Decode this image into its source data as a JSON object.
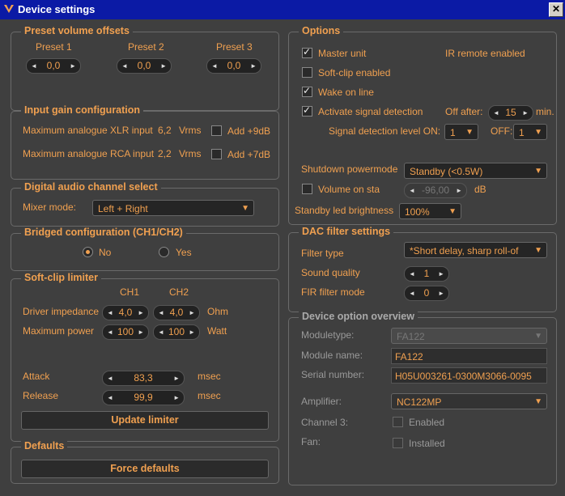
{
  "window": {
    "title": "Device settings",
    "close": "✕"
  },
  "preset": {
    "legend": "Preset volume offsets",
    "items": [
      {
        "label": "Preset 1",
        "value": "0,0"
      },
      {
        "label": "Preset 2",
        "value": "0,0"
      },
      {
        "label": "Preset 3",
        "value": "0,0"
      }
    ]
  },
  "input_gain": {
    "legend": "Input gain configuration",
    "xlr_label": "Maximum analogue XLR input",
    "xlr_value": "6,2",
    "xlr_unit": "Vrms",
    "xlr_check": "Add +9dB",
    "rca_label": "Maximum analogue RCA input",
    "rca_value": "2,2",
    "rca_unit": "Vrms",
    "rca_check": "Add +7dB"
  },
  "digital": {
    "legend": "Digital audio channel select",
    "mixer_label": "Mixer mode:",
    "mixer_value": "Left + Right"
  },
  "bridged": {
    "legend": "Bridged configuration (CH1/CH2)",
    "no": "No",
    "yes": "Yes"
  },
  "softclip": {
    "legend": "Soft-clip limiter",
    "ch1": "CH1",
    "ch2": "CH2",
    "impedance_label": "Driver impedance",
    "impedance_ch1": "4,0",
    "impedance_ch2": "4,0",
    "impedance_unit": "Ohm",
    "power_label": "Maximum power",
    "power_ch1": "100",
    "power_ch2": "100",
    "power_unit": "Watt",
    "attack_label": "Attack",
    "attack_value": "83,3",
    "attack_unit": "msec",
    "release_label": "Release",
    "release_value": "99,9",
    "release_unit": "msec",
    "update_button": "Update limiter"
  },
  "defaults": {
    "legend": "Defaults",
    "button": "Force defaults"
  },
  "options": {
    "legend": "Options",
    "master_unit": "Master unit",
    "ir_remote": "IR remote enabled",
    "soft_clip": "Soft-clip enabled",
    "wake_on_line": "Wake on line",
    "signal_detection": "Activate signal detection",
    "off_after_label": "Off after:",
    "off_after_value": "15",
    "off_after_unit": "min.",
    "sig_level_label": "Signal detection level ON:",
    "sig_on_value": "1",
    "off_label": "OFF:",
    "sig_off_value": "1",
    "shutdown_label": "Shutdown powermode",
    "shutdown_value": "Standby (<0.5W)",
    "volume_on_start": "Volume on sta",
    "volume_value": "-96,00",
    "volume_unit": "dB",
    "led_label": "Standby led brightness",
    "led_value": "100%"
  },
  "dac": {
    "legend": "DAC filter settings",
    "filter_label": "Filter type",
    "filter_value": "*Short delay, sharp roll-of",
    "quality_label": "Sound quality",
    "quality_value": "1",
    "fir_label": "FIR filter mode",
    "fir_value": "0"
  },
  "overview": {
    "legend": "Device option overview",
    "moduletype_label": "Moduletype:",
    "moduletype_value": "FA122",
    "module_name_label": "Module name:",
    "module_name_value": "FA122",
    "serial_label": "Serial number:",
    "serial_value": "H05U003261-0300M3066-0095",
    "amplifier_label": "Amplifier:",
    "amplifier_value": "NC122MP",
    "channel3_label": "Channel 3:",
    "channel3_check": "Enabled",
    "fan_label": "Fan:",
    "fan_check": "Installed"
  }
}
